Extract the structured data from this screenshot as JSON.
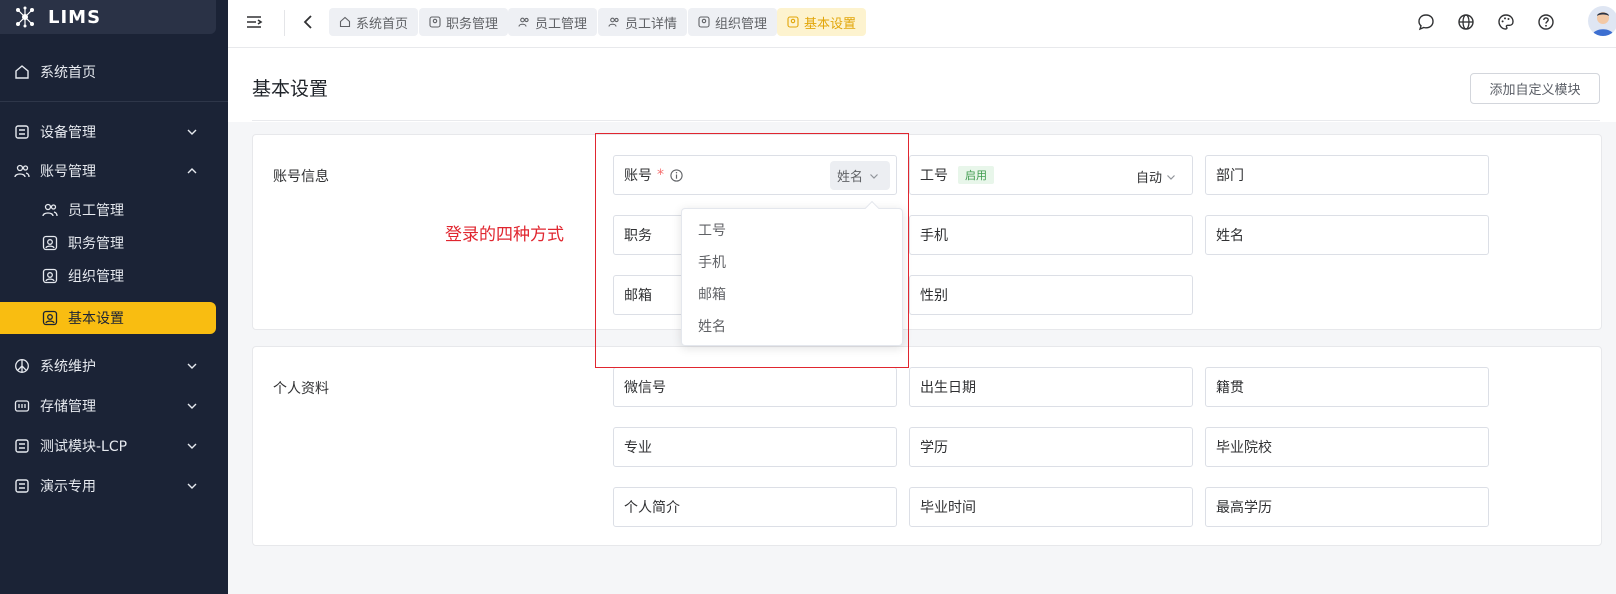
{
  "app": {
    "name": "LIMS"
  },
  "sidebar": {
    "items": [
      {
        "label": "系统首页",
        "icon": "home-icon"
      },
      {
        "label": "设备管理",
        "icon": "grid-icon"
      },
      {
        "label": "账号管理",
        "icon": "users-icon"
      },
      {
        "label": "员工管理",
        "icon": "users-icon"
      },
      {
        "label": "职务管理",
        "icon": "badge-icon"
      },
      {
        "label": "组织管理",
        "icon": "badge-icon"
      },
      {
        "label": "基本设置",
        "icon": "badge-icon",
        "active": true
      },
      {
        "label": "系统维护",
        "icon": "peace-icon"
      },
      {
        "label": "存储管理",
        "icon": "storage-icon"
      },
      {
        "label": "测试模块-LCP",
        "icon": "grid-icon"
      },
      {
        "label": "演示专用",
        "icon": "grid-icon"
      }
    ]
  },
  "topbar": {
    "tabs": [
      {
        "label": "系统首页"
      },
      {
        "label": "职务管理"
      },
      {
        "label": "员工管理"
      },
      {
        "label": "员工详情"
      },
      {
        "label": "组织管理"
      },
      {
        "label": "基本设置",
        "active": true
      }
    ],
    "icons": [
      "menu-toggle-icon",
      "back-icon",
      "message-icon",
      "globe-icon",
      "palette-icon",
      "help-icon",
      "avatar"
    ]
  },
  "page": {
    "title": "基本设置",
    "add_button": "添加自定义模块"
  },
  "account_card": {
    "label": "账号信息",
    "account_field": {
      "label": "账号",
      "required_mark": "*",
      "select_value": "姓名"
    },
    "employee_no_field": {
      "label": "工号",
      "badge": "启用",
      "select_value": "自动"
    },
    "fields": [
      "部门",
      "职务",
      "手机",
      "姓名",
      "邮箱",
      "性别"
    ]
  },
  "profile_card": {
    "label": "个人资料",
    "fields": [
      "微信号",
      "出生日期",
      "籍贯",
      "专业",
      "学历",
      "毕业院校",
      "个人简介",
      "毕业时间",
      "最高学历"
    ]
  },
  "dropdown": {
    "options": [
      "工号",
      "手机",
      "邮箱",
      "姓名"
    ]
  },
  "annotation": {
    "note": "登录的四种方式",
    "color": "#e0262f"
  },
  "colors": {
    "sidebar_bg": "#1b2336",
    "accent": "#f9bd11"
  }
}
